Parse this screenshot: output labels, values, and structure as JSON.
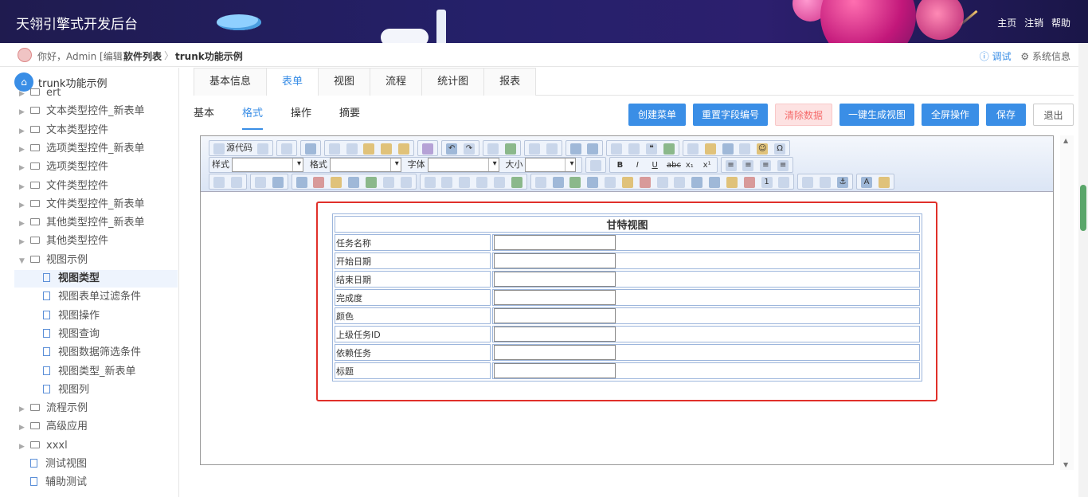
{
  "header": {
    "title": "天翎引擎式开发后台",
    "links": [
      "主页",
      "注销",
      "帮助"
    ]
  },
  "breadcrumb": {
    "greeting": "你好，Admin [编辑]",
    "items": [
      "软件列表",
      "trunk功能示例"
    ],
    "separator": "〉",
    "debug": "ⓘ 调试",
    "sysinfo": "⚙ 系统信息"
  },
  "sidebar": {
    "root": "trunk功能示例",
    "items": [
      {
        "label": "ert",
        "type": "folder"
      },
      {
        "label": "文本类型控件_新表单",
        "type": "folder"
      },
      {
        "label": "文本类型控件",
        "type": "folder"
      },
      {
        "label": "选项类型控件_新表单",
        "type": "folder"
      },
      {
        "label": "选项类型控件",
        "type": "folder"
      },
      {
        "label": "文件类型控件",
        "type": "folder"
      },
      {
        "label": "文件类型控件_新表单",
        "type": "folder"
      },
      {
        "label": "其他类型控件_新表单",
        "type": "folder"
      },
      {
        "label": "其他类型控件",
        "type": "folder"
      },
      {
        "label": "视图示例",
        "type": "folder-open"
      },
      {
        "label": "视图类型",
        "type": "doc",
        "active": true
      },
      {
        "label": "视图表单过滤条件",
        "type": "doc"
      },
      {
        "label": "视图操作",
        "type": "doc"
      },
      {
        "label": "视图查询",
        "type": "doc"
      },
      {
        "label": "视图数据筛选条件",
        "type": "doc"
      },
      {
        "label": "视图类型_新表单",
        "type": "doc"
      },
      {
        "label": "视图列",
        "type": "doc"
      },
      {
        "label": "流程示例",
        "type": "folder"
      },
      {
        "label": "高级应用",
        "type": "folder"
      },
      {
        "label": "xxxl",
        "type": "folder"
      },
      {
        "label": "测试视图",
        "type": "doc-root"
      },
      {
        "label": "辅助测试",
        "type": "doc-root"
      }
    ]
  },
  "tabs_main": [
    "基本信息",
    "表单",
    "视图",
    "流程",
    "统计图",
    "报表"
  ],
  "tabs_main_active": 1,
  "tabs_sub": [
    "基本",
    "格式",
    "操作",
    "摘要"
  ],
  "tabs_sub_active": 1,
  "actions": {
    "create_menu": "创建菜单",
    "reset_field_no": "重置字段编号",
    "clear_data": "清除数据",
    "gen_view": "一键生成视图",
    "fullscreen": "全屏操作",
    "save": "保存",
    "exit": "退出"
  },
  "toolbar": {
    "source": "源代码",
    "style_label": "样式",
    "format_label": "格式",
    "font_label": "字体",
    "size_label": "大小"
  },
  "form": {
    "title": "甘特视图",
    "fields": [
      "任务名称",
      "开始日期",
      "结束日期",
      "完成度",
      "颜色",
      "上级任务ID",
      "依赖任务",
      "标题"
    ]
  },
  "colors": {
    "accent": "#3a8ee6",
    "selection": "#e0302a",
    "header_bg": "#25206a"
  }
}
